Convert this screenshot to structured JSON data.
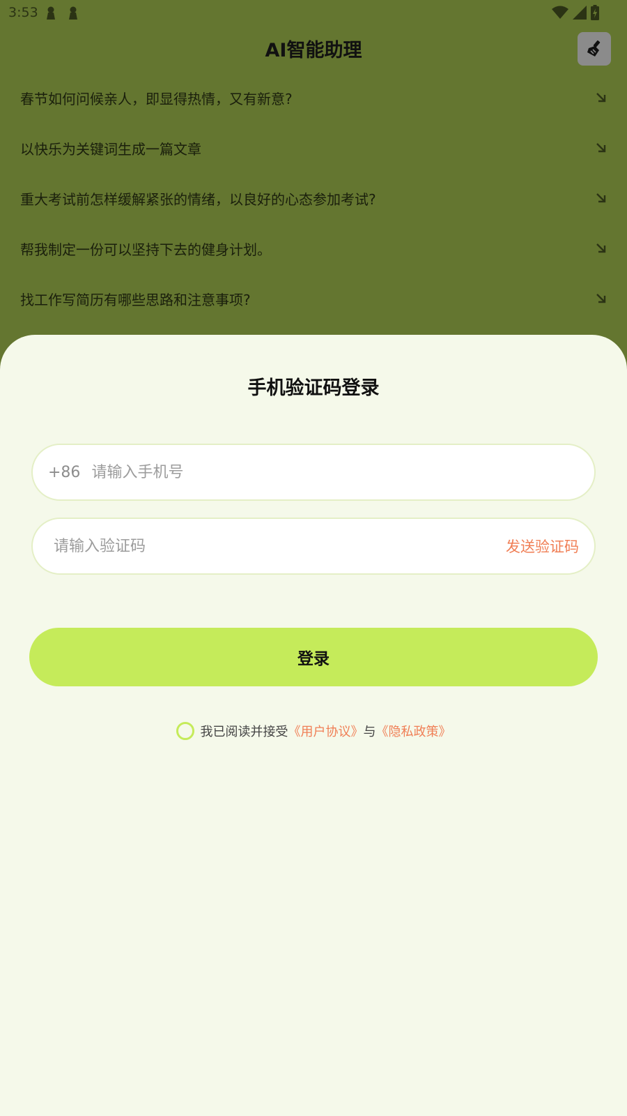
{
  "status_bar": {
    "time": "3:53"
  },
  "header": {
    "title": "AI智能助理"
  },
  "suggestions": [
    "春节如何问候亲人，即显得热情，又有新意?",
    "以快乐为关键词生成一篇文章",
    "重大考试前怎样缓解紧张的情绪，以良好的心态参加考试?",
    "帮我制定一份可以坚持下去的健身计划。",
    "找工作写简历有哪些思路和注意事项?"
  ],
  "login": {
    "title": "手机验证码登录",
    "phone_prefix": "+86",
    "phone_placeholder": "请输入手机号",
    "code_placeholder": "请输入验证码",
    "send_code_label": "发送验证码",
    "login_label": "登录",
    "agree_text": "我已阅读并接受",
    "user_agreement": "《用户协议》",
    "and_text": "与",
    "privacy_policy": "《隐私政策》"
  },
  "colors": {
    "background": "#647630",
    "sheet": "#f5f9ea",
    "accent": "#c5eb5a",
    "link": "#f07f56"
  }
}
